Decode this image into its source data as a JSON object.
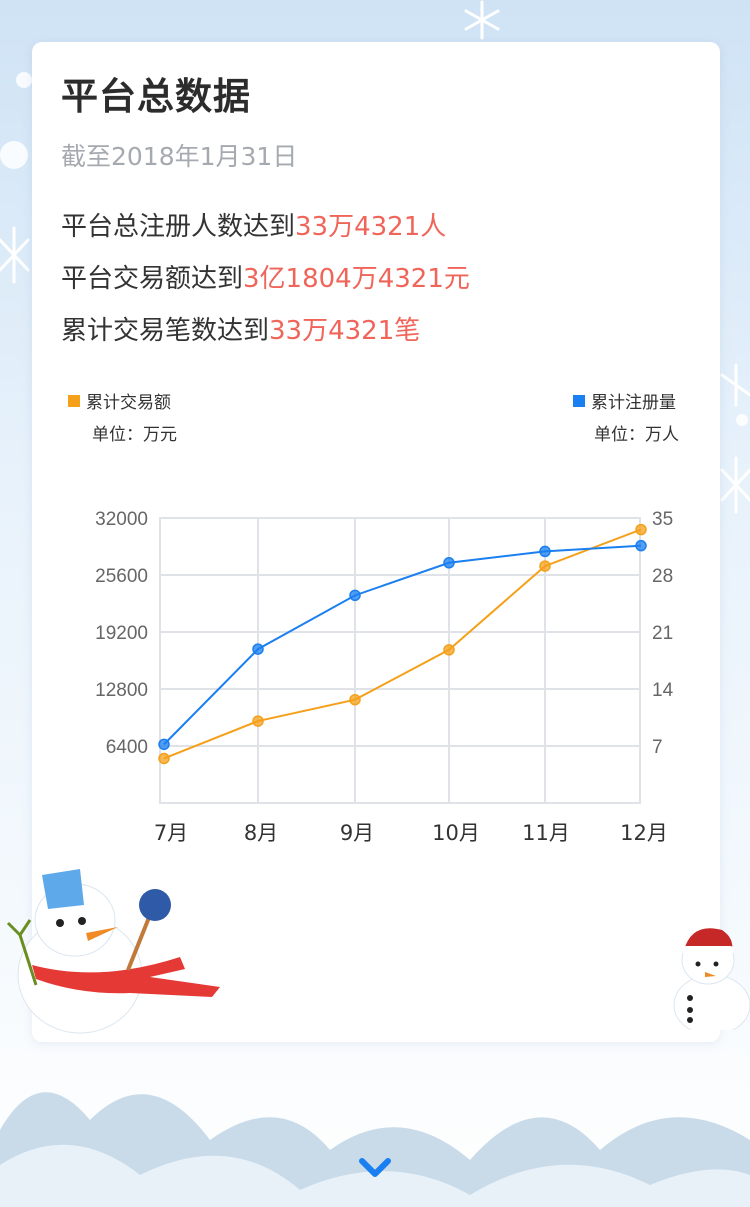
{
  "title": "平台总数据",
  "subtitle": "截至2018年1月31日",
  "stats": [
    {
      "prefix": "平台总注册人数达到",
      "highlight": "33万4321人"
    },
    {
      "prefix": "平台交易额达到",
      "highlight": "3亿1804万4321元"
    },
    {
      "prefix": "累计交易笔数达到",
      "highlight": "33万4321笔"
    }
  ],
  "colors": {
    "highlight": "#f0655a",
    "amount": "#f5a01a",
    "users": "#1a7ff0"
  },
  "chart_data": {
    "type": "line",
    "categories": [
      "7月",
      "8月",
      "9月",
      "10月",
      "11月",
      "12月"
    ],
    "left_axis": {
      "legend": "累计交易额",
      "unit": "单位：万元",
      "ticks": [
        6400,
        12800,
        19200,
        25600,
        32000
      ],
      "range": [
        0,
        32000
      ]
    },
    "right_axis": {
      "legend": "累计注册量",
      "unit": "单位：万人",
      "ticks": [
        7,
        14,
        21,
        28,
        35
      ],
      "range": [
        0,
        35
      ]
    },
    "series": [
      {
        "name": "累计交易额",
        "axis": "left",
        "color": "#f5a01a",
        "values": [
          5000,
          9200,
          11600,
          17200,
          26600,
          30700
        ]
      },
      {
        "name": "累计注册量",
        "axis": "right",
        "color": "#1a7ff0",
        "values": [
          7.2,
          18.9,
          25.5,
          29.5,
          30.9,
          31.6
        ]
      }
    ],
    "grid": true,
    "legend_position": "top"
  },
  "icons": {
    "scroll_down": "chevron-down-icon"
  }
}
